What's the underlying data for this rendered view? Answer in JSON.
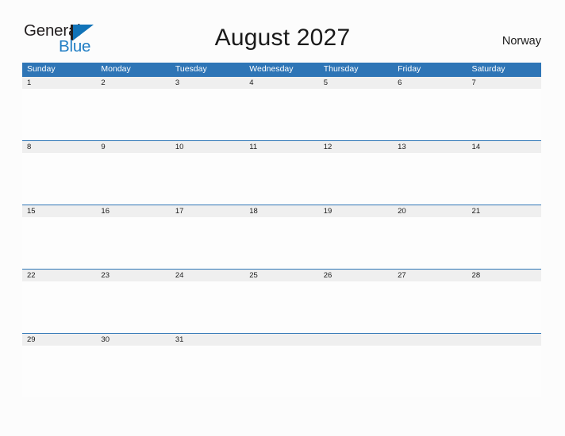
{
  "header": {
    "logo": {
      "word1": "General",
      "word2": "Blue",
      "triangle_color": "#1173b8",
      "word2_color": "#1f7dc4"
    },
    "title": "August 2027",
    "country": "Norway"
  },
  "theme": {
    "header_blue": "#2e75b6",
    "date_band_gray": "#efefef",
    "page_background": "#fcfcfc",
    "text_dark": "#1a1a1a",
    "weekday_text": "#ffffff"
  },
  "calendar": {
    "month": "August",
    "year": "2027",
    "weekdays": [
      "Sunday",
      "Monday",
      "Tuesday",
      "Wednesday",
      "Thursday",
      "Friday",
      "Saturday"
    ],
    "weeks": [
      [
        "1",
        "2",
        "3",
        "4",
        "5",
        "6",
        "7"
      ],
      [
        "8",
        "9",
        "10",
        "11",
        "12",
        "13",
        "14"
      ],
      [
        "15",
        "16",
        "17",
        "18",
        "19",
        "20",
        "21"
      ],
      [
        "22",
        "23",
        "24",
        "25",
        "26",
        "27",
        "28"
      ],
      [
        "29",
        "30",
        "31",
        "",
        "",
        "",
        ""
      ]
    ]
  }
}
